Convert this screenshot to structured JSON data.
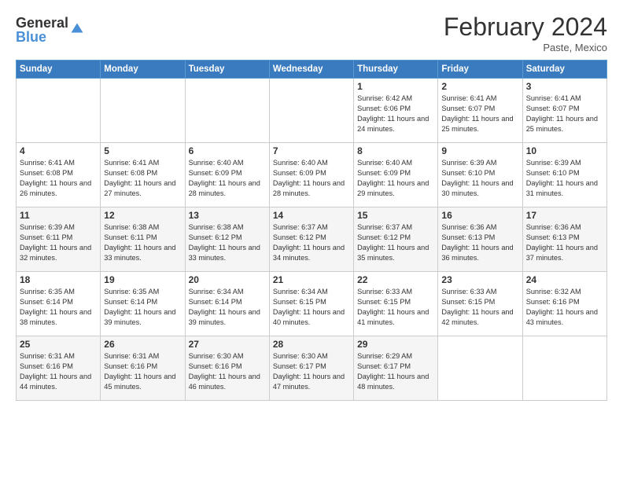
{
  "logo": {
    "general": "General",
    "blue": "Blue"
  },
  "title": "February 2024",
  "location": "Paste, Mexico",
  "days_of_week": [
    "Sunday",
    "Monday",
    "Tuesday",
    "Wednesday",
    "Thursday",
    "Friday",
    "Saturday"
  ],
  "weeks": [
    [
      {
        "day": "",
        "info": ""
      },
      {
        "day": "",
        "info": ""
      },
      {
        "day": "",
        "info": ""
      },
      {
        "day": "",
        "info": ""
      },
      {
        "day": "1",
        "info": "Sunrise: 6:42 AM\nSunset: 6:06 PM\nDaylight: 11 hours and 24 minutes."
      },
      {
        "day": "2",
        "info": "Sunrise: 6:41 AM\nSunset: 6:07 PM\nDaylight: 11 hours and 25 minutes."
      },
      {
        "day": "3",
        "info": "Sunrise: 6:41 AM\nSunset: 6:07 PM\nDaylight: 11 hours and 25 minutes."
      }
    ],
    [
      {
        "day": "4",
        "info": "Sunrise: 6:41 AM\nSunset: 6:08 PM\nDaylight: 11 hours and 26 minutes."
      },
      {
        "day": "5",
        "info": "Sunrise: 6:41 AM\nSunset: 6:08 PM\nDaylight: 11 hours and 27 minutes."
      },
      {
        "day": "6",
        "info": "Sunrise: 6:40 AM\nSunset: 6:09 PM\nDaylight: 11 hours and 28 minutes."
      },
      {
        "day": "7",
        "info": "Sunrise: 6:40 AM\nSunset: 6:09 PM\nDaylight: 11 hours and 28 minutes."
      },
      {
        "day": "8",
        "info": "Sunrise: 6:40 AM\nSunset: 6:09 PM\nDaylight: 11 hours and 29 minutes."
      },
      {
        "day": "9",
        "info": "Sunrise: 6:39 AM\nSunset: 6:10 PM\nDaylight: 11 hours and 30 minutes."
      },
      {
        "day": "10",
        "info": "Sunrise: 6:39 AM\nSunset: 6:10 PM\nDaylight: 11 hours and 31 minutes."
      }
    ],
    [
      {
        "day": "11",
        "info": "Sunrise: 6:39 AM\nSunset: 6:11 PM\nDaylight: 11 hours and 32 minutes."
      },
      {
        "day": "12",
        "info": "Sunrise: 6:38 AM\nSunset: 6:11 PM\nDaylight: 11 hours and 33 minutes."
      },
      {
        "day": "13",
        "info": "Sunrise: 6:38 AM\nSunset: 6:12 PM\nDaylight: 11 hours and 33 minutes."
      },
      {
        "day": "14",
        "info": "Sunrise: 6:37 AM\nSunset: 6:12 PM\nDaylight: 11 hours and 34 minutes."
      },
      {
        "day": "15",
        "info": "Sunrise: 6:37 AM\nSunset: 6:12 PM\nDaylight: 11 hours and 35 minutes."
      },
      {
        "day": "16",
        "info": "Sunrise: 6:36 AM\nSunset: 6:13 PM\nDaylight: 11 hours and 36 minutes."
      },
      {
        "day": "17",
        "info": "Sunrise: 6:36 AM\nSunset: 6:13 PM\nDaylight: 11 hours and 37 minutes."
      }
    ],
    [
      {
        "day": "18",
        "info": "Sunrise: 6:35 AM\nSunset: 6:14 PM\nDaylight: 11 hours and 38 minutes."
      },
      {
        "day": "19",
        "info": "Sunrise: 6:35 AM\nSunset: 6:14 PM\nDaylight: 11 hours and 39 minutes."
      },
      {
        "day": "20",
        "info": "Sunrise: 6:34 AM\nSunset: 6:14 PM\nDaylight: 11 hours and 39 minutes."
      },
      {
        "day": "21",
        "info": "Sunrise: 6:34 AM\nSunset: 6:15 PM\nDaylight: 11 hours and 40 minutes."
      },
      {
        "day": "22",
        "info": "Sunrise: 6:33 AM\nSunset: 6:15 PM\nDaylight: 11 hours and 41 minutes."
      },
      {
        "day": "23",
        "info": "Sunrise: 6:33 AM\nSunset: 6:15 PM\nDaylight: 11 hours and 42 minutes."
      },
      {
        "day": "24",
        "info": "Sunrise: 6:32 AM\nSunset: 6:16 PM\nDaylight: 11 hours and 43 minutes."
      }
    ],
    [
      {
        "day": "25",
        "info": "Sunrise: 6:31 AM\nSunset: 6:16 PM\nDaylight: 11 hours and 44 minutes."
      },
      {
        "day": "26",
        "info": "Sunrise: 6:31 AM\nSunset: 6:16 PM\nDaylight: 11 hours and 45 minutes."
      },
      {
        "day": "27",
        "info": "Sunrise: 6:30 AM\nSunset: 6:16 PM\nDaylight: 11 hours and 46 minutes."
      },
      {
        "day": "28",
        "info": "Sunrise: 6:30 AM\nSunset: 6:17 PM\nDaylight: 11 hours and 47 minutes."
      },
      {
        "day": "29",
        "info": "Sunrise: 6:29 AM\nSunset: 6:17 PM\nDaylight: 11 hours and 48 minutes."
      },
      {
        "day": "",
        "info": ""
      },
      {
        "day": "",
        "info": ""
      }
    ]
  ]
}
